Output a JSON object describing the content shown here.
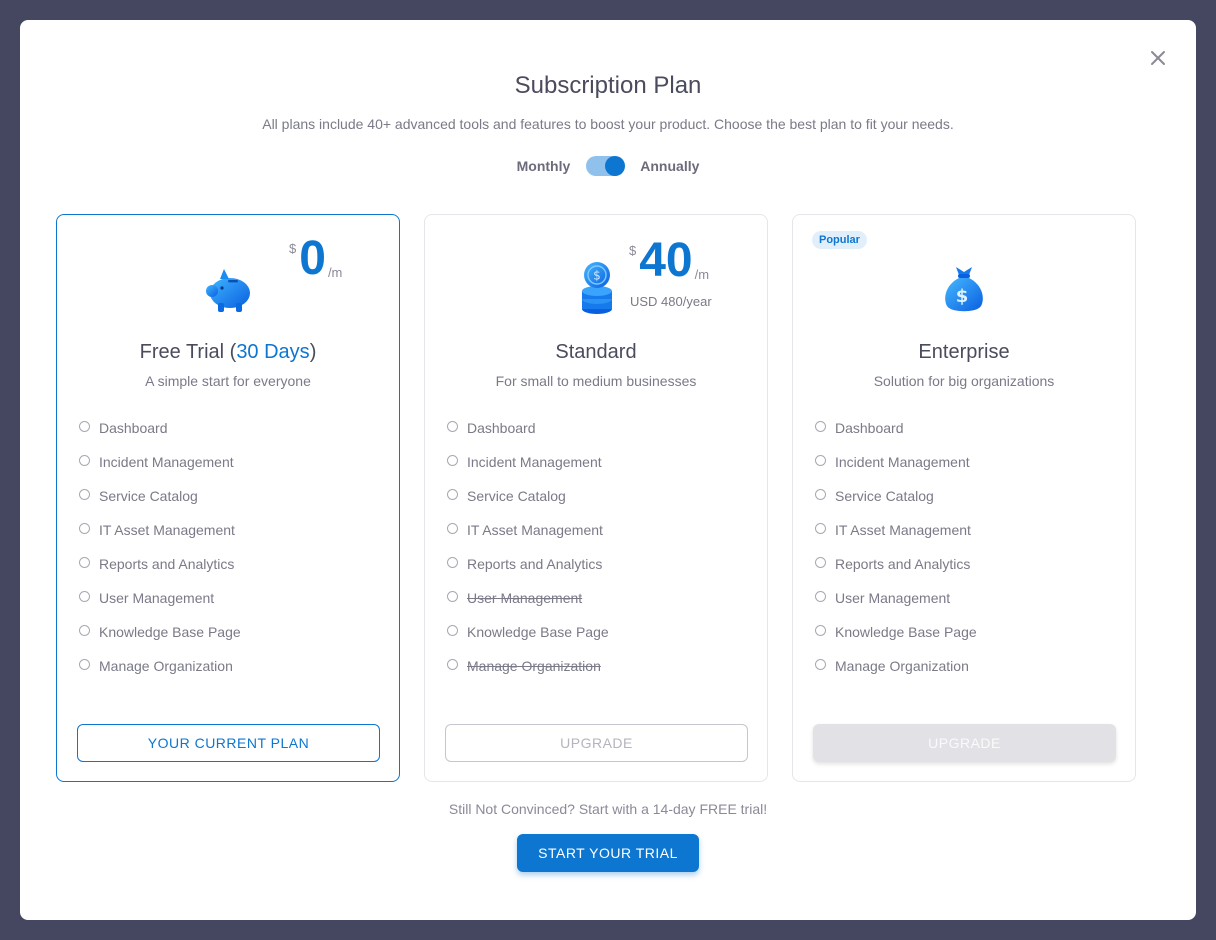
{
  "modal": {
    "title": "Subscription Plan",
    "subtitle": "All plans include 40+ advanced tools and features to boost your product. Choose the best plan to fit your needs.",
    "close_icon": "close-icon"
  },
  "billing": {
    "monthly_label": "Monthly",
    "annually_label": "Annually",
    "toggle_state": "annually"
  },
  "plans": [
    {
      "name_prefix": "Free Trial (",
      "name_highlight": "30 Days",
      "name_suffix": ")",
      "description": "A simple start for everyone",
      "currency": "$",
      "price": "0",
      "period": "/m",
      "icon": "piggy-bank-icon",
      "features": [
        "Dashboard",
        "Incident Management",
        "Service Catalog",
        "IT Asset Management",
        "Reports and Analytics",
        "User Management",
        "Knowledge Base Page",
        "Manage Organization"
      ],
      "button_label": "YOUR CURRENT PLAN",
      "current": true
    },
    {
      "name": "Standard",
      "description": "For small to medium businesses",
      "currency": "$",
      "price": "40",
      "period": "/m",
      "yearly": "USD 480/year",
      "icon": "coins-icon",
      "features": [
        "Dashboard",
        "Incident Management",
        "Service Catalog",
        "IT Asset Management",
        "Reports and Analytics",
        "User Management",
        "Knowledge Base Page",
        "Manage Organization"
      ],
      "struck_features": [
        "User Management",
        "Manage Organization"
      ],
      "button_label": "UPGRADE"
    },
    {
      "badge": "Popular",
      "name": "Enterprise",
      "description": "Solution for big organizations",
      "icon": "money-bag-icon",
      "features": [
        "Dashboard",
        "Incident Management",
        "Service Catalog",
        "IT Asset Management",
        "Reports and Analytics",
        "User Management",
        "Knowledge Base Page",
        "Manage Organization"
      ],
      "button_label": "UPGRADE"
    }
  ],
  "footer": {
    "note": "Still Not Convinced? Start with a 14-day FREE trial!",
    "trial_button": "START YOUR TRIAL"
  },
  "colors": {
    "accent": "#0d76d0",
    "backdrop": "#454761",
    "text": "#4b4b5e",
    "muted": "#7a7a88"
  }
}
